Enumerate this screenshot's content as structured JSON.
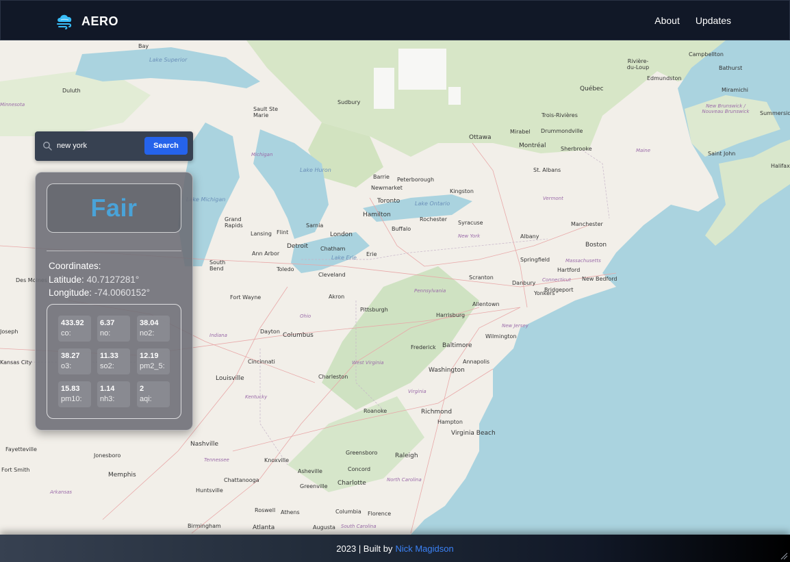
{
  "header": {
    "brand": "AERO",
    "nav": [
      "About",
      "Updates"
    ]
  },
  "search": {
    "value": "new york",
    "button_label": "Search"
  },
  "panel": {
    "quality": "Fair",
    "coords_title": "Coordinates:",
    "latitude_label": "Latitude:",
    "latitude_value": "40.7127281°",
    "longitude_label": "Longitude:",
    "longitude_value": "-74.0060152°",
    "pollutants": [
      {
        "value": "433.92",
        "key": "co:"
      },
      {
        "value": "6.37",
        "key": "no:"
      },
      {
        "value": "38.04",
        "key": "no2:"
      },
      {
        "value": "38.27",
        "key": "o3:"
      },
      {
        "value": "11.33",
        "key": "so2:"
      },
      {
        "value": "12.19",
        "key": "pm2_5:"
      },
      {
        "value": "15.83",
        "key": "pm10:"
      },
      {
        "value": "1.14",
        "key": "nh3:"
      },
      {
        "value": "2",
        "key": "aqi:"
      }
    ]
  },
  "map": {
    "places": [
      "Bay",
      "Lake Superior",
      "Duluth",
      "Minnesota",
      "Sault Ste Marie",
      "Sudbury",
      "Québec",
      "Rivière-du-Loup",
      "Edmundston",
      "Campbellton",
      "Bathurst",
      "Miramichi",
      "Summerside",
      "New Brunswick / Nouveau Brunswick",
      "Trois-Rivières",
      "Drummondville",
      "Mirabel",
      "Sherbrooke",
      "Ottawa",
      "Montréal",
      "Maine",
      "Saint John",
      "Halifax",
      "Michigan",
      "Lake Huron",
      "St. Albans",
      "Barrie",
      "Peterborough",
      "Newmarket",
      "Kingston",
      "Toronto",
      "Lake Ontario",
      "Vermont",
      "Grand Rapids",
      "Sarnia",
      "Hamilton",
      "Rochester",
      "Syracuse",
      "Manchester",
      "Lansing",
      "Flint",
      "London",
      "Buffalo",
      "New York",
      "Albany",
      "Boston",
      "Detroit",
      "Chatham",
      "Erie",
      "Springfield",
      "Massachusetts",
      "Ann Arbor",
      "South Bend",
      "Toledo",
      "Lake Erie",
      "Hartford",
      "New Bedford",
      "Des Moines",
      "Cleveland",
      "Scranton",
      "Danbury",
      "Connecticut",
      "Fort Wayne",
      "Akron",
      "Pennsylvania",
      "Yonkers",
      "Bridgeport",
      "Allentown",
      "Pittsburgh",
      "Harrisburg",
      "Ohio",
      "Joseph",
      "Indiana",
      "Dayton",
      "Columbus",
      "Wilmington",
      "New Jersey",
      "Frederick",
      "Baltimore",
      "Kansas City",
      "Cincinnati",
      "West Virginia",
      "Annapolis",
      "Washington",
      "Louisville",
      "Charleston",
      "Virginia",
      "Kentucky",
      "Richmond",
      "Roanoke",
      "Hampton",
      "Virginia Beach",
      "Nashville",
      "Fayetteville",
      "Jonesboro",
      "Tennessee",
      "Knoxville",
      "Greensboro",
      "Raleigh",
      "Fort Smith",
      "Concord",
      "Memphis",
      "Asheville",
      "Charlotte",
      "North Carolina",
      "Greenville",
      "Arkansas",
      "Huntsville",
      "Chattanooga",
      "Columbia",
      "Florence",
      "Roswell",
      "Athens",
      "Birmingham",
      "Atlanta",
      "Augusta",
      "South Carolina",
      "Lake Michigan"
    ]
  },
  "footer": {
    "text": "2023 | Built by",
    "link": "Nick Magidson"
  }
}
